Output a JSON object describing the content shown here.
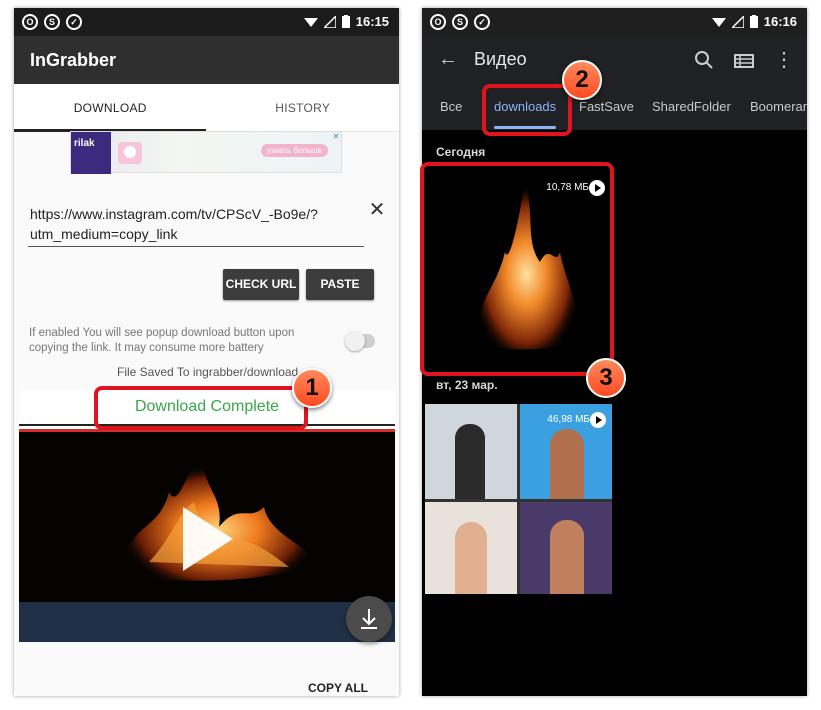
{
  "left_phone": {
    "status_bar": {
      "time": "16:15",
      "icons": [
        "opera-icon",
        "shazam-icon",
        "check-icon"
      ]
    },
    "app_title": "InGrabber",
    "tabs": [
      {
        "label": "DOWNLOAD",
        "active": true
      },
      {
        "label": "HISTORY",
        "active": false
      }
    ],
    "ad": {
      "brand": "rilak",
      "pill_text": "узнать больше"
    },
    "url_input": {
      "value": "https://www.instagram.com/tv/CPScV_-Bo9e/?utm_medium=copy_link"
    },
    "buttons": {
      "check_url": "CHECK URL",
      "paste": "PASTE",
      "copy_all": "COPY ALL"
    },
    "hint": "If enabled You will see popup download button upon copying the link. It may consume more battery",
    "popup_toggle": {
      "on": false
    },
    "saved_message": "File Saved To ingrabber/download",
    "download_status": "Download Complete",
    "colors": {
      "appbar": "#2f2f2f",
      "status_green": "#3aa64a",
      "accent_red": "#d32f2f"
    }
  },
  "right_phone": {
    "status_bar": {
      "time": "16:16",
      "icons": [
        "opera-icon",
        "shazam-icon",
        "check-icon"
      ]
    },
    "title": "Видео",
    "chips": [
      {
        "label": "Все",
        "active": false
      },
      {
        "label": "downloads",
        "active": true
      },
      {
        "label": "FastSave",
        "active": false
      },
      {
        "label": "SharedFolder",
        "active": false
      },
      {
        "label": "Boomerang",
        "active": false
      }
    ],
    "sections": [
      {
        "label": "Сегодня",
        "items": [
          {
            "size": "10,78 МБ",
            "kind": "video"
          }
        ]
      },
      {
        "label": "вт, 23 мар.",
        "items": [
          {
            "size": "46,98 МБ",
            "kind": "video"
          }
        ]
      }
    ],
    "colors": {
      "chip_underline": "#8ab4f8",
      "appbar": "#202124"
    }
  },
  "annotations": [
    {
      "number": "1"
    },
    {
      "number": "2"
    },
    {
      "number": "3"
    }
  ]
}
